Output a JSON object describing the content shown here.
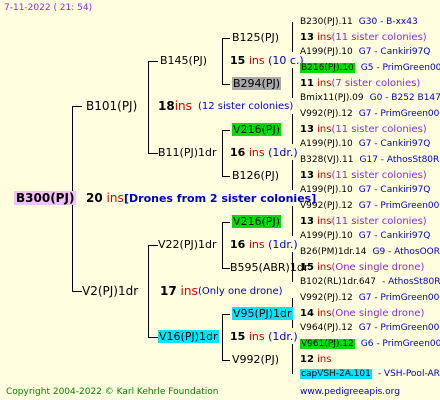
{
  "header": {
    "date": "7-11-2022 ( 21: 54)"
  },
  "footer": {
    "copyright": "Copyright 2004-2022 © Karl Kehrle Foundation",
    "site": "www.pedigreeapis.org"
  },
  "root": {
    "label": "B300(PJ)",
    "count": "20",
    "ins": "ins",
    "note": "[Drones from 2 sister colonies]"
  },
  "gen1": {
    "a": {
      "label": "B101(PJ)",
      "count": "18",
      "ins": "ins",
      "note": "(12 sister colonies)"
    },
    "b": {
      "label": "V2(PJ)1dr",
      "count": "17",
      "ins": "ins",
      "note": "(Only one drone)"
    }
  },
  "gen2": {
    "a": {
      "label": "B145(PJ)",
      "count": "15",
      "ins": "ins",
      "note": "(10 c.)"
    },
    "b": {
      "label": "B11(PJ)1dr",
      "count": "16",
      "ins": "ins",
      "note": "(1dr.)"
    },
    "c": {
      "label": "V22(PJ)1dr",
      "count": "16",
      "ins": "ins",
      "note": "(1dr.)"
    },
    "d": {
      "label": "V16(PJ)1dr",
      "count": "15",
      "ins": "ins",
      "note": "(1dr.)"
    }
  },
  "gen3": {
    "a": {
      "label": "B125(PJ)",
      "count": "13",
      "ins": "ins",
      "note": "(11 sister colonies)"
    },
    "b": {
      "label": "B294(PJ)",
      "count": "11",
      "ins": "ins",
      "note": "(7 sister colonies)"
    },
    "c": {
      "label": "V216(PJ)",
      "count": "13",
      "ins": "ins",
      "note": "(11 sister colonies)"
    },
    "d": {
      "label": "B126(PJ)",
      "count": "13",
      "ins": "ins",
      "note": "(11 sister colonies)"
    },
    "e": {
      "label": "V216(PJ)",
      "count": "13",
      "ins": "ins",
      "note": "(11 sister colonies)"
    },
    "f": {
      "label": "B595(ABR)1dr",
      "count": "15",
      "ins": "ins",
      "note": "(One single drone)"
    },
    "g": {
      "label": "V95(PJ)1dr",
      "count": "14",
      "ins": "ins",
      "note": "(One single drone)"
    },
    "h": {
      "label": "V992(PJ)",
      "count": "12",
      "ins": "ins",
      "note": ""
    }
  },
  "gen4": [
    {
      "label": "B230(PJ).11",
      "extra": "G30 - B-xx43"
    },
    {
      "label": "A199(PJ).10",
      "extra": "G7 - Cankiri97Q"
    },
    {
      "label": "B216(PJ).10",
      "extra": "G5 - PrimGreen00"
    },
    {
      "label": "Bmix11(PJ).09",
      "extra": "G0 - B252 B147 B"
    },
    {
      "label": "V992(PJ).12",
      "extra": "G7 - PrimGreen00"
    },
    {
      "label": "A199(PJ).10",
      "extra": "G7 - Cankiri97Q"
    },
    {
      "label": "B328(VJ).11",
      "extra": "G17 - AthosSt80R"
    },
    {
      "label": "A199(PJ).10",
      "extra": "G7 - Cankiri97Q"
    },
    {
      "label": "V992(PJ).12",
      "extra": "G7 - PrimGreen00"
    },
    {
      "label": "A199(PJ).10",
      "extra": "G7 - Cankiri97Q"
    },
    {
      "label": "B26(PM)1dr.14",
      "extra": "G9 - AthosOOR"
    },
    {
      "label": "B102(RL)1dr.647",
      "extra": "- AthosSt80R"
    },
    {
      "label": "V992(PJ).12",
      "extra": "G7 - PrimGreen00"
    },
    {
      "label": "V964(PJ).12",
      "extra": "G7 - PrimGreen00"
    },
    {
      "label": "V961(PJ).12",
      "extra": "G6 - PrimGreen00"
    },
    {
      "label": "capVSH-2A.101",
      "extra": "- VSH-Pool-AR"
    }
  ]
}
